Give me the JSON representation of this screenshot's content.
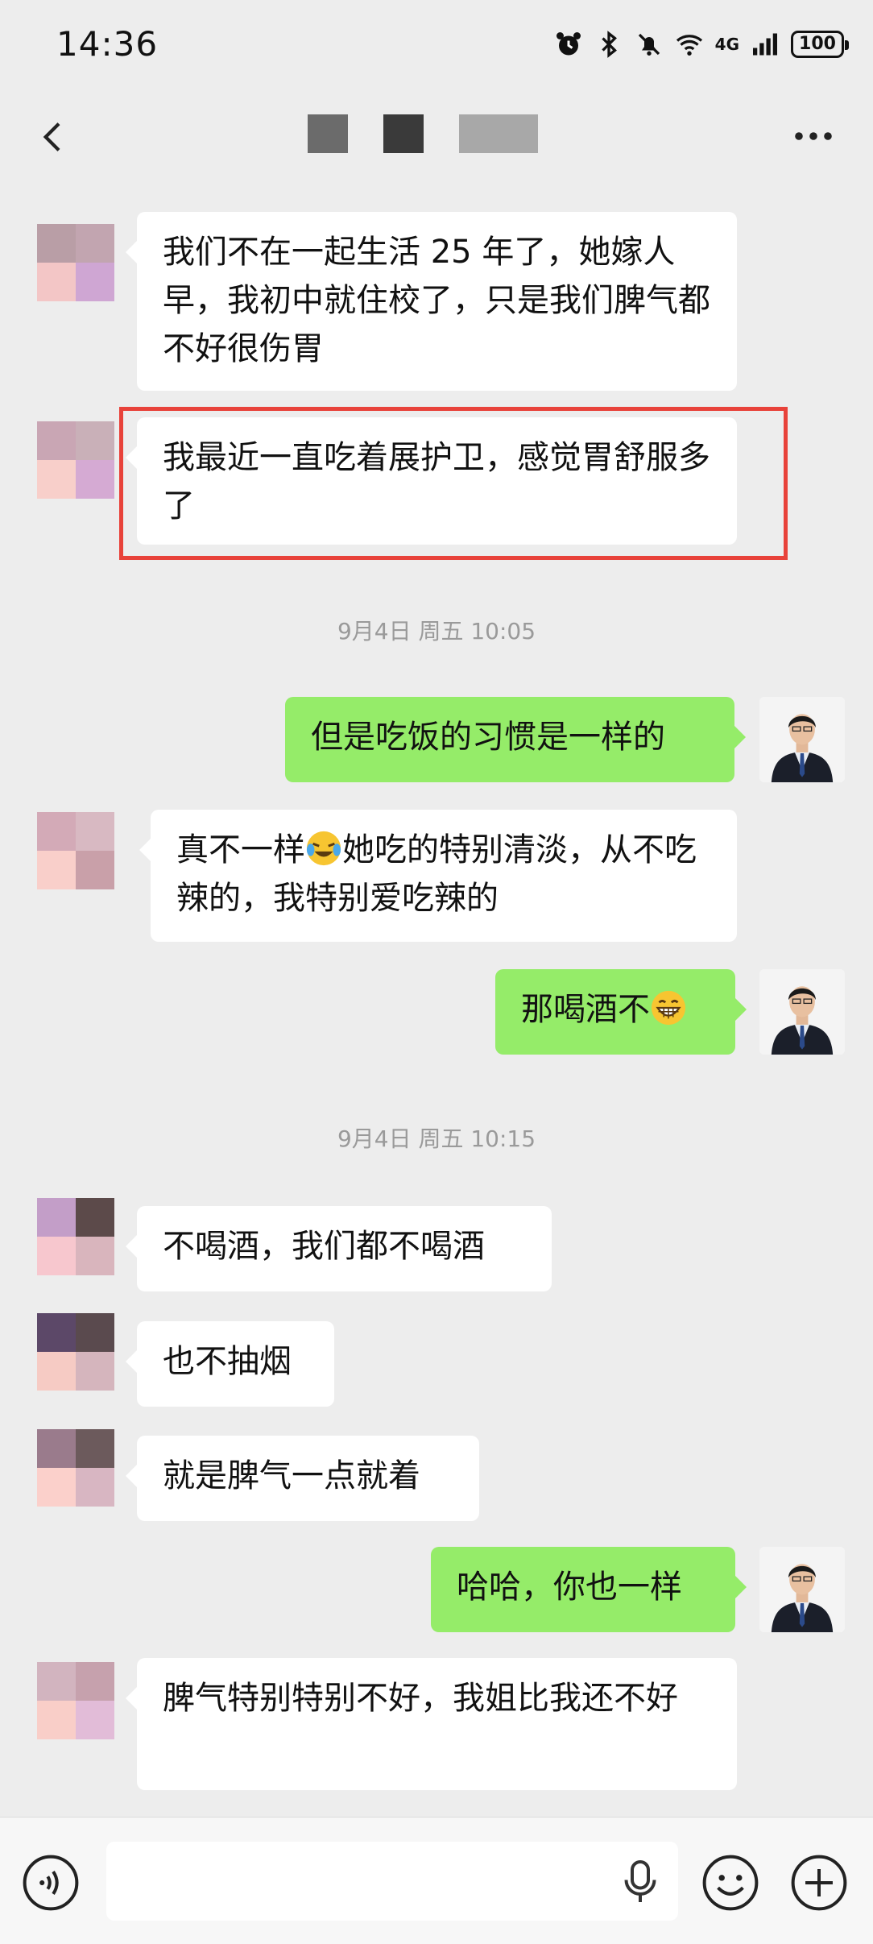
{
  "status_bar": {
    "time": "14:36",
    "network": "4G",
    "battery": "100"
  },
  "header": {
    "back_icon": "chevron-left-icon",
    "more_icon": "more-dots-icon"
  },
  "colors": {
    "background": "#ededed",
    "incoming_bubble": "#ffffff",
    "outgoing_bubble": "#95ec69",
    "highlight": "#e8423a"
  },
  "messages": [
    {
      "side": "left",
      "text": "我们不在一起生活 25 年了，她嫁人早，我初中就住校了，只是我们脾气都不好很伤胃"
    },
    {
      "side": "left",
      "text": "我最近一直吃着展护卫，感觉胃舒服多了",
      "highlighted": true
    },
    {
      "type": "timestamp",
      "text": "9月4日 周五 10:05"
    },
    {
      "side": "right",
      "text": "但是吃饭的习惯是一样的"
    },
    {
      "side": "left",
      "text_before_emoji": "真不一样",
      "emoji": "crying-laughing-emoji",
      "text_after_emoji": "她吃的特别清淡，从不吃辣的，我特别爱吃辣的"
    },
    {
      "side": "right",
      "text": "那喝酒不",
      "emoji": "grinning-emoji"
    },
    {
      "type": "timestamp",
      "text": "9月4日 周五 10:15"
    },
    {
      "side": "left",
      "text": "不喝酒，我们都不喝酒"
    },
    {
      "side": "left",
      "text": "也不抽烟"
    },
    {
      "side": "left",
      "text": "就是脾气一点就着"
    },
    {
      "side": "right",
      "text": "哈哈，你也一样"
    },
    {
      "side": "left",
      "text": "脾气特别特别不好，我姐比我还不好"
    }
  ],
  "input_bar": {
    "placeholder": "",
    "voice_icon": "voice-icon",
    "mic_icon": "microphone-icon",
    "emoji_icon": "smiley-icon",
    "plus_icon": "plus-icon"
  }
}
